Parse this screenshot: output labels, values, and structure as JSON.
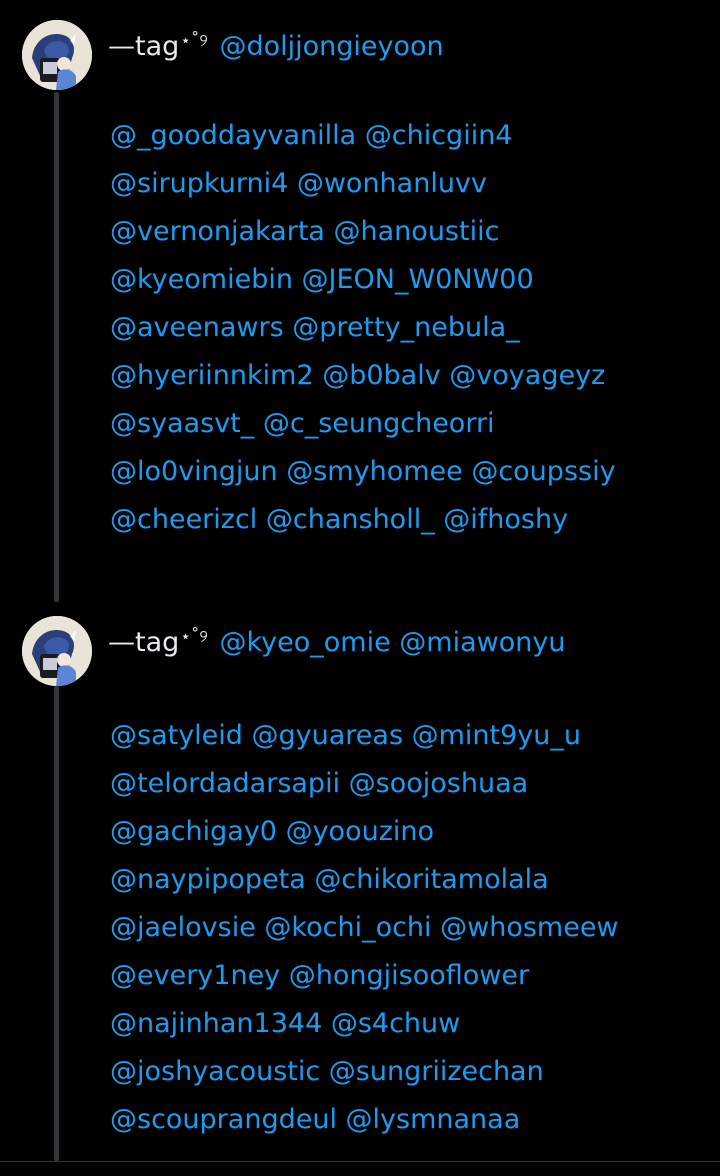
{
  "posts": [
    {
      "author": "—tag",
      "author_mark": "⋆˚୨",
      "header_mentions": "@doljjongieyoon",
      "lines": [
        "@_gooddayvanilla @chicgiin4",
        "@sirupkurni4 @wonhanluvv",
        "@vernonjakarta @hanoustiic",
        "@kyeomiebin @JEON_W0NW00",
        "@aveenawrs @pretty_nebula_",
        "@hyeriinnkim2 @b0balv @voyageyz",
        "@syaasvt_ @c_seungcheorri",
        "@lo0vingjun @smyhomee @coupssiy",
        "@cheerizcl @chansholl_ @ifhoshy"
      ]
    },
    {
      "author": "—tag",
      "author_mark": "⋆˚୨",
      "header_mentions": "@kyeo_omie @miawonyu",
      "lines": [
        "@satyleid @gyuareas @mint9yu_u",
        "@telordadarsapii @soojoshuaa",
        "@gachigay0 @yoouzino",
        "@naypipopeta @chikoritamolala",
        "@jaelovsie @kochi_ochi @whosmeew",
        "@every1ney @hongjisooflower",
        "@najinhan1344 @s4chuw",
        "@joshyacoustic @sungriizechan",
        "@scouprangdeul @lysmnanaa"
      ]
    }
  ],
  "colors": {
    "background": "#000000",
    "text": "#e7e9ea",
    "mention": "#1d9bf0",
    "thread_line": "#333639"
  }
}
